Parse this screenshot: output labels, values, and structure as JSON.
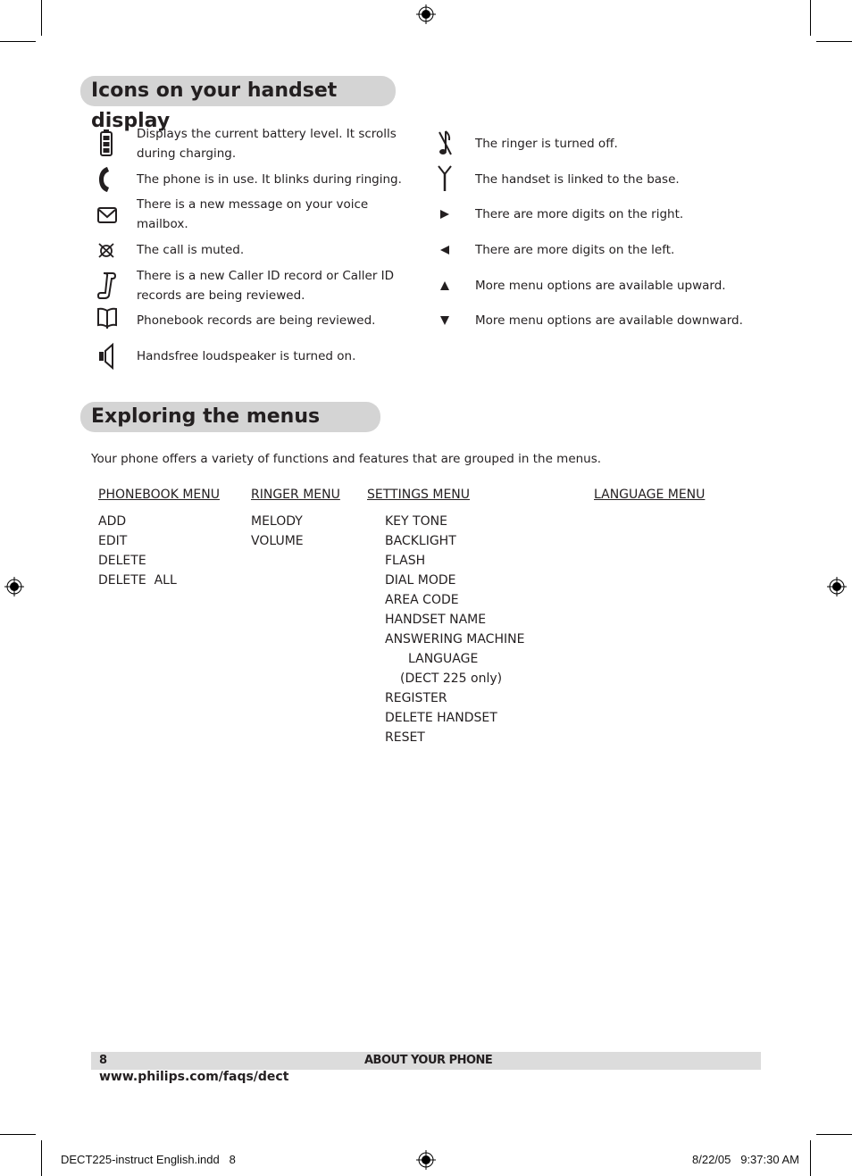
{
  "sections": {
    "icons_title": "Icons on your handset display",
    "menus_title": "Exploring the menus"
  },
  "icons_left": [
    {
      "icon": "battery-icon",
      "text_lines": [
        "Displays the current battery level.  It scrolls",
        "during charging."
      ]
    },
    {
      "icon": "phone-handset-icon",
      "text_lines": [
        "The phone is in use.  It blinks during ringing."
      ]
    },
    {
      "icon": "envelope-icon",
      "text_lines": [
        "There is a new message on your voice",
        "mailbox."
      ]
    },
    {
      "icon": "mute-icon",
      "text_lines": [
        "The call is muted."
      ]
    },
    {
      "icon": "caller-id-scroll-icon",
      "text_lines": [
        "There is a new Caller ID record or Caller ID",
        "records are being reviewed."
      ]
    },
    {
      "icon": "book-icon",
      "text_lines": [
        "Phonebook records are being reviewed."
      ]
    },
    {
      "icon": "speaker-icon",
      "text_lines": [
        "Handsfree loudspeaker is turned on."
      ]
    }
  ],
  "icons_right": [
    {
      "icon": "ringer-off-icon",
      "text": "The ringer is turned off."
    },
    {
      "icon": "antenna-icon",
      "text": "The handset is linked to the base."
    },
    {
      "icon": "arrow-right-icon",
      "text": "There are more digits on the right."
    },
    {
      "icon": "arrow-left-icon",
      "text": "There are more digits on the left."
    },
    {
      "icon": "arrow-up-icon",
      "text": "More menu options are available upward."
    },
    {
      "icon": "arrow-down-icon",
      "text": "More menu options are available downward."
    }
  ],
  "menus_intro": "Your phone offers a variety of functions and features that are grouped in the menus.",
  "menus": [
    {
      "title": "PHONEBOOK MENU",
      "items": [
        "ADD",
        "EDIT",
        "DELETE",
        "DELETE  ALL"
      ]
    },
    {
      "title": "RINGER MENU",
      "items": [
        "MELODY",
        "VOLUME"
      ]
    },
    {
      "title": "SETTINGS MENU",
      "items": [
        "KEY TONE",
        "BACKLIGHT",
        "FLASH",
        "DIAL MODE",
        "AREA CODE",
        "HANDSET NAME",
        "ANSWERING MACHINE",
        "LANGUAGE",
        "(DECT 225 only)",
        "REGISTER",
        "DELETE HANDSET",
        "RESET"
      ]
    },
    {
      "title": "LANGUAGE MENU",
      "items": []
    }
  ],
  "footer": {
    "page_number": "8",
    "section": "ABOUT YOUR PHONE",
    "url": "www.philips.com/faqs/dect"
  },
  "slug": {
    "file": "DECT225-instruct English.indd   8",
    "date": "8/22/05   9:37:30 AM"
  }
}
